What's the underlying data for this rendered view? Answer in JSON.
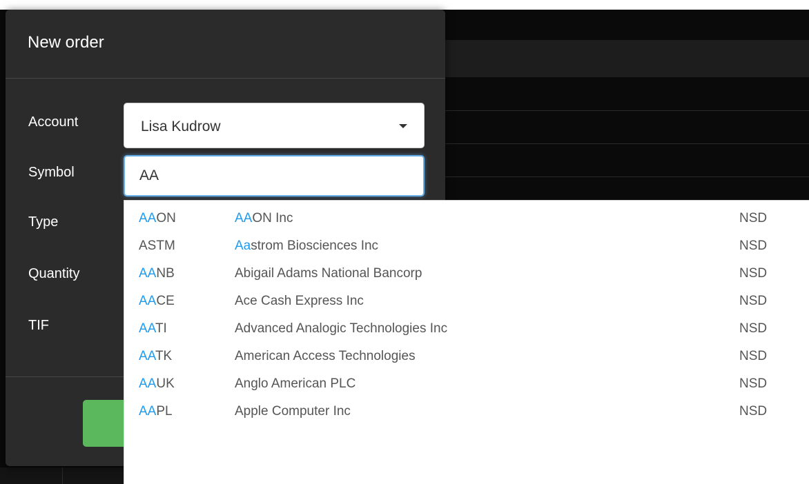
{
  "dialog": {
    "title": "New order",
    "labels": {
      "account": "Account",
      "symbol": "Symbol",
      "type": "Type",
      "quantity": "Quantity",
      "tif": "TIF"
    },
    "account_value": "Lisa Kudrow",
    "symbol_value": "AA"
  },
  "autocomplete": {
    "query": "AA",
    "items": [
      {
        "hl_symbol": "AA",
        "rest_symbol": "ON",
        "hl_name": "AA",
        "rest_name": "ON Inc",
        "exchange": "NSD"
      },
      {
        "hl_symbol": "",
        "rest_symbol": "ASTM",
        "hl_name": "Aa",
        "rest_name": "strom Biosciences Inc",
        "exchange": "NSD"
      },
      {
        "hl_symbol": "AA",
        "rest_symbol": "NB",
        "hl_name": "",
        "rest_name": "Abigail Adams National Bancorp",
        "exchange": "NSD"
      },
      {
        "hl_symbol": "AA",
        "rest_symbol": "CE",
        "hl_name": "",
        "rest_name": "Ace Cash Express Inc",
        "exchange": "NSD"
      },
      {
        "hl_symbol": "AA",
        "rest_symbol": "TI",
        "hl_name": "",
        "rest_name": "Advanced Analogic Technologies Inc",
        "exchange": "NSD"
      },
      {
        "hl_symbol": "AA",
        "rest_symbol": "TK",
        "hl_name": "",
        "rest_name": "American Access Technologies",
        "exchange": "NSD"
      },
      {
        "hl_symbol": "AA",
        "rest_symbol": "UK",
        "hl_name": "",
        "rest_name": "Anglo American PLC",
        "exchange": "NSD"
      },
      {
        "hl_symbol": "AA",
        "rest_symbol": "PL",
        "hl_name": "",
        "rest_name": "Apple Computer Inc",
        "exchange": "NSD"
      }
    ]
  },
  "colors": {
    "highlight": "#1e9bf0",
    "dialog_bg": "#2b2b2b",
    "submit_green": "#5cb85c",
    "focus_blue": "#66afe9"
  },
  "icons": {
    "account_dropdown": "caret-down-icon"
  }
}
